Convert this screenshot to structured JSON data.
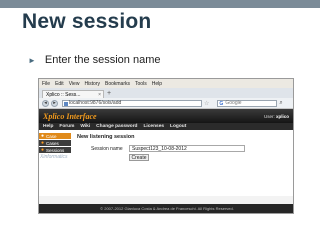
{
  "slide": {
    "title": "New session",
    "bullet": "Enter the session name"
  },
  "browser": {
    "menu": [
      "File",
      "Edit",
      "View",
      "History",
      "Bookmarks",
      "Tools",
      "Help"
    ],
    "tab_label": "Xplico :: Sess...",
    "tab_plus": "+",
    "url": "localhost:9876/sols/add",
    "search_engine": "G",
    "search_placeholder": "Google",
    "nav_back": "◂",
    "nav_forward": "▸"
  },
  "app": {
    "title": "Xplico Interface",
    "user_label": "User:",
    "user_name": "xplico",
    "nav": [
      "Help",
      "Forum",
      "Wiki",
      "Change password",
      "Licenses",
      "Logout"
    ],
    "sidebar": [
      {
        "label": "Case",
        "active": true
      },
      {
        "label": "Cases",
        "active": false
      },
      {
        "label": "Sessions",
        "active": false
      }
    ],
    "sidebar_faded": "Xinformatics",
    "content_title": "New listening session",
    "session_label": "Session name",
    "session_value": "Suspect123_10-08-2012",
    "create_label": "Create",
    "footer": "© 2007-2012 Gianluca Costa & Andrea de Franceschi. All Rights Reserved."
  },
  "colors": {
    "title": "#243c4d",
    "accent_orange": "#f29b1e",
    "header_dark": "#151515"
  }
}
